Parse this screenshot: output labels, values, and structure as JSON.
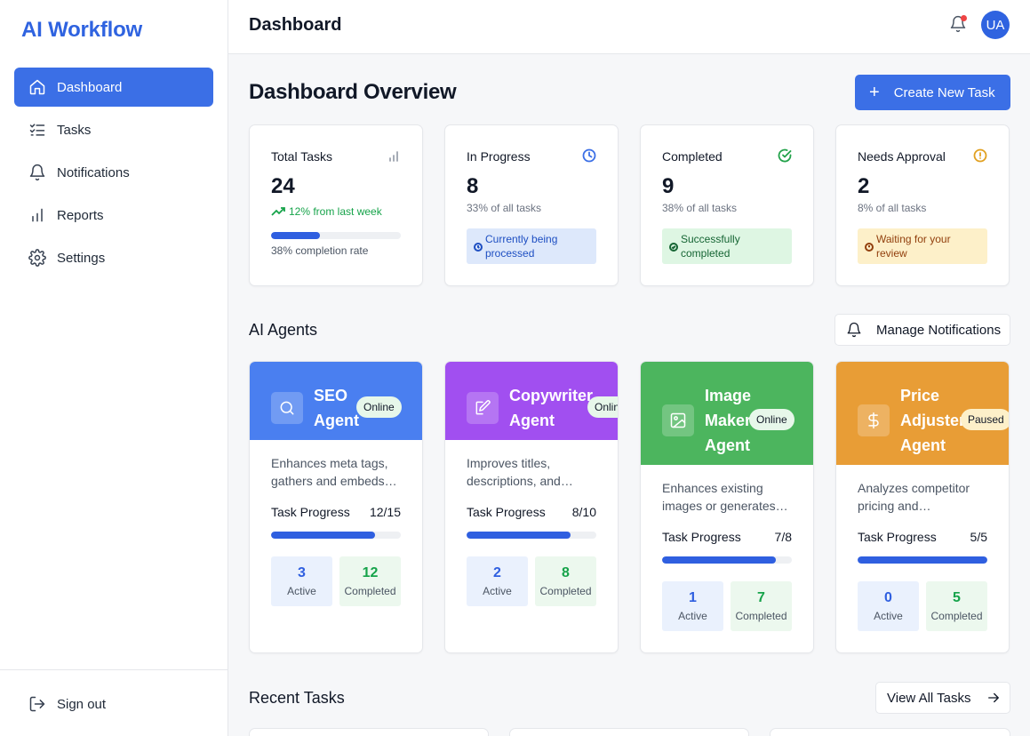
{
  "app": {
    "brand": "AI Workflow"
  },
  "sidebar": {
    "items": [
      {
        "label": "Dashboard",
        "icon": "home-icon",
        "active": true
      },
      {
        "label": "Tasks",
        "icon": "list-checks-icon"
      },
      {
        "label": "Notifications",
        "icon": "bell-icon"
      },
      {
        "label": "Reports",
        "icon": "bar-chart-icon"
      },
      {
        "label": "Settings",
        "icon": "gear-icon"
      }
    ],
    "signout": "Sign out"
  },
  "header": {
    "title": "Dashboard",
    "avatar_initials": "UA"
  },
  "overview": {
    "title": "Dashboard Overview",
    "create_button": "Create New Task"
  },
  "stats": {
    "total": {
      "label": "Total Tasks",
      "value": "24",
      "trend": "12% from last week",
      "completion_rate": 0.38,
      "rate_text": "38% completion rate"
    },
    "in_progress": {
      "label": "In Progress",
      "value": "8",
      "sub": "33% of all tasks",
      "status": "Currently being processed"
    },
    "completed": {
      "label": "Completed",
      "value": "9",
      "sub": "38% of all tasks",
      "status": "Successfully completed"
    },
    "approval": {
      "label": "Needs Approval",
      "value": "2",
      "sub": "8% of all tasks",
      "status": "Waiting for your review"
    }
  },
  "agents_section": {
    "title": "AI Agents",
    "manage_button": "Manage Notifications"
  },
  "agents": [
    {
      "name": "SEO Agent",
      "status": "Online",
      "color": "#4a7ff0",
      "icon": "search-icon",
      "description": "Enhances meta tags, gathers and embeds…",
      "progress_label": "Task Progress",
      "progress_text": "12/15",
      "progress": 0.8,
      "active": "3",
      "active_label": "Active",
      "completed": "12",
      "completed_label": "Completed"
    },
    {
      "name": "Copywriter Agent",
      "status": "Online",
      "color": "#a14ff0",
      "icon": "edit-icon",
      "description": "Improves titles, descriptions, and…",
      "progress_label": "Task Progress",
      "progress_text": "8/10",
      "progress": 0.8,
      "active": "2",
      "active_label": "Active",
      "completed": "8",
      "completed_label": "Completed"
    },
    {
      "name": "Image Maker Agent",
      "status": "Online",
      "color": "#4cb55e",
      "icon": "image-icon",
      "description": "Enhances existing images or generates…",
      "progress_label": "Task Progress",
      "progress_text": "7/8",
      "progress": 0.875,
      "active": "1",
      "active_label": "Active",
      "completed": "7",
      "completed_label": "Completed"
    },
    {
      "name": "Price Adjuster Agent",
      "status": "Paused",
      "color": "#e89d36",
      "icon": "dollar-icon",
      "description": "Analyzes competitor pricing and…",
      "progress_label": "Task Progress",
      "progress_text": "5/5",
      "progress": 1.0,
      "active": "0",
      "active_label": "Active",
      "completed": "5",
      "completed_label": "Completed"
    }
  ],
  "recent": {
    "title": "Recent Tasks",
    "view_all": "View All Tasks"
  }
}
